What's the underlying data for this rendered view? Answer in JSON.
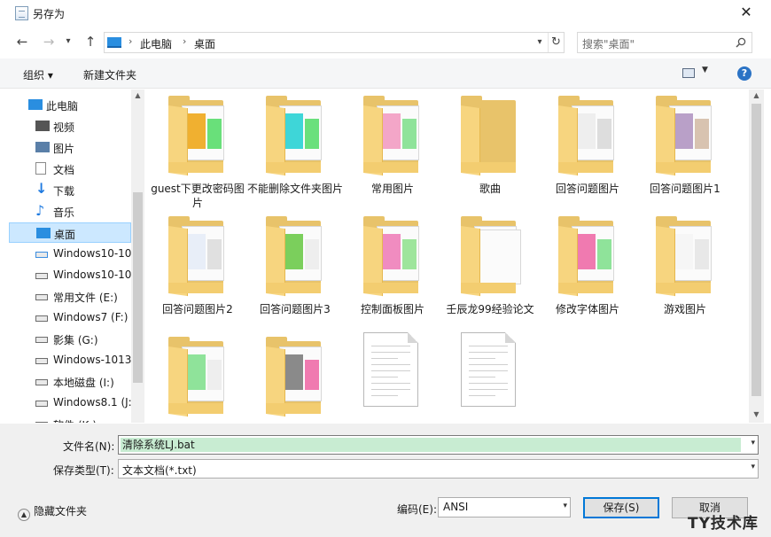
{
  "window": {
    "title": "另存为"
  },
  "address": {
    "path": [
      "此电脑",
      "桌面"
    ]
  },
  "search": {
    "placeholder": "搜索\"桌面\""
  },
  "toolbar": {
    "organize": "组织 ▾",
    "new_folder": "新建文件夹"
  },
  "nav": {
    "items": [
      {
        "label": "此电脑",
        "icon": "pc-icon",
        "indent": 0
      },
      {
        "label": "视频",
        "icon": "video-icon",
        "indent": 1
      },
      {
        "label": "图片",
        "icon": "picture-icon",
        "indent": 1
      },
      {
        "label": "文档",
        "icon": "document-icon",
        "indent": 1
      },
      {
        "label": "下载",
        "icon": "download-icon",
        "indent": 1
      },
      {
        "label": "音乐",
        "icon": "music-icon",
        "indent": 1
      },
      {
        "label": "桌面",
        "icon": "desktop-icon",
        "indent": 1,
        "selected": true
      },
      {
        "label": "Windows10-10",
        "icon": "windows-drive-icon",
        "indent": 1
      },
      {
        "label": "Windows10-10",
        "icon": "drive-icon",
        "indent": 1
      },
      {
        "label": "常用文件 (E:)",
        "icon": "drive-icon",
        "indent": 1
      },
      {
        "label": "Windows7 (F:)",
        "icon": "drive-icon",
        "indent": 1
      },
      {
        "label": "影集 (G:)",
        "icon": "drive-icon",
        "indent": 1
      },
      {
        "label": "Windows-1013",
        "icon": "drive-icon",
        "indent": 1
      },
      {
        "label": "本地磁盘 (I:)",
        "icon": "drive-icon",
        "indent": 1
      },
      {
        "label": "Windows8.1 (J:",
        "icon": "drive-icon",
        "indent": 1
      },
      {
        "label": "软件 (K:)",
        "icon": "drive-icon",
        "indent": 1
      }
    ]
  },
  "files": [
    {
      "name": "guest下更改密码图片",
      "type": "folder",
      "preview": [
        "#f0b030",
        "#69e07a"
      ]
    },
    {
      "name": "不能删除文件夹图片",
      "type": "folder",
      "preview": [
        "#3ed6d8",
        "#6ae07c"
      ]
    },
    {
      "name": "常用图片",
      "type": "folder",
      "preview": [
        "#f3a6c8",
        "#8fe39a"
      ]
    },
    {
      "name": "歌曲",
      "type": "folder",
      "preview": []
    },
    {
      "name": "回答问题图片",
      "type": "folder",
      "preview": [
        "#eeeeee",
        "#dddddd"
      ]
    },
    {
      "name": "回答问题图片1",
      "type": "folder",
      "preview": [
        "#b9a0c8",
        "#d8c3b0"
      ]
    },
    {
      "name": "回答问题图片2",
      "type": "folder",
      "preview": [
        "#e8eef8",
        "#e0e0e0"
      ]
    },
    {
      "name": "回答问题图片3",
      "type": "folder",
      "preview": [
        "#7bcf5c",
        "#eeeeee"
      ]
    },
    {
      "name": "控制面板图片",
      "type": "folder",
      "preview": [
        "#f08cc0",
        "#9ee59c"
      ]
    },
    {
      "name": "壬辰龙99经验论文",
      "type": "stack",
      "preview": []
    },
    {
      "name": "修改字体图片",
      "type": "folder",
      "preview": [
        "#f07ab0",
        "#8fe39a"
      ]
    },
    {
      "name": "游戏图片",
      "type": "folder",
      "preview": [
        "#f6f6f6",
        "#e8e8e8"
      ]
    },
    {
      "name": "",
      "type": "folder",
      "preview": [
        "#8fe39a",
        "#eeeeee"
      ]
    },
    {
      "name": "",
      "type": "folder",
      "preview": [
        "#8a8a8a",
        "#f07ab0"
      ]
    },
    {
      "name": "",
      "type": "document",
      "preview": []
    },
    {
      "name": "",
      "type": "document",
      "preview": []
    }
  ],
  "form": {
    "filename_label": "文件名(N):",
    "filename_value": "清除系统LJ.bat",
    "filetype_label": "保存类型(T):",
    "filetype_value": "文本文档(*.txt)",
    "hide_folders": "隐藏文件夹",
    "encoding_label": "编码(E):",
    "encoding_value": "ANSI",
    "save": "保存(S)",
    "cancel": "取消"
  },
  "watermark": "TY技术库"
}
